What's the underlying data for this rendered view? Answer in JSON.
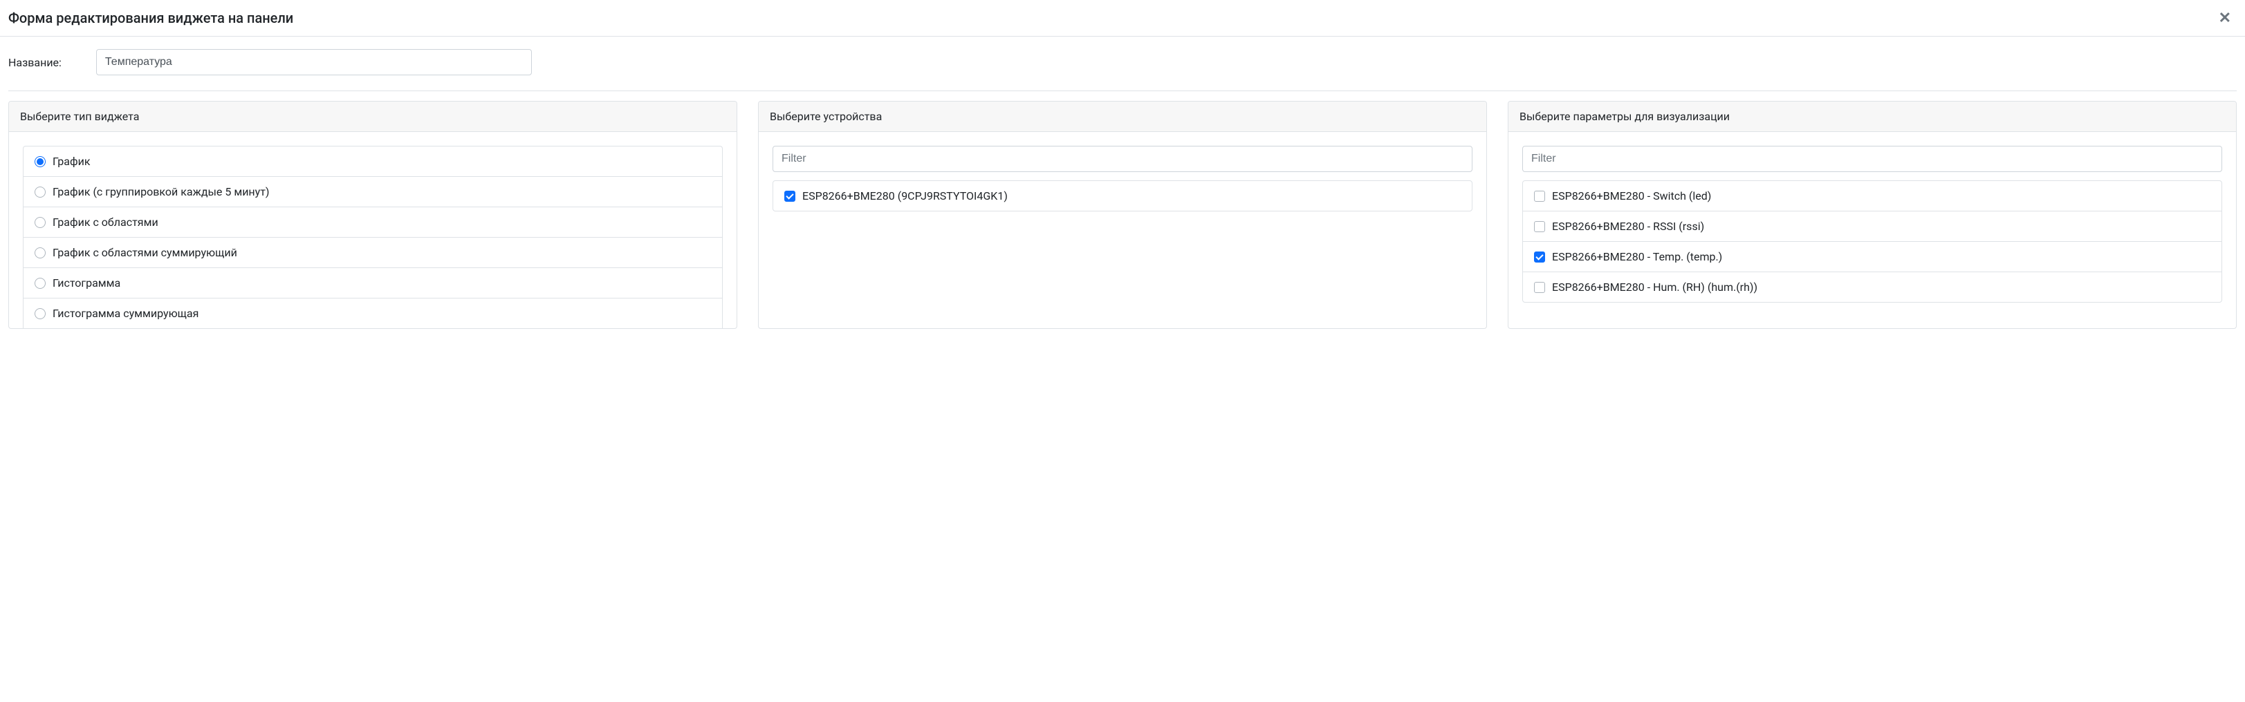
{
  "modal": {
    "title": "Форма редактирования виджета на панели"
  },
  "nameField": {
    "label": "Название:",
    "value": "Температура"
  },
  "widgetTypePanel": {
    "title": "Выберите тип виджета",
    "options": [
      {
        "label": "График",
        "checked": true
      },
      {
        "label": "График (с группировкой каждые 5 минут)",
        "checked": false
      },
      {
        "label": "График с областями",
        "checked": false
      },
      {
        "label": "График с областями суммирующий",
        "checked": false
      },
      {
        "label": "Гистограмма",
        "checked": false
      },
      {
        "label": "Гистограмма суммирующая",
        "checked": false
      }
    ]
  },
  "devicesPanel": {
    "title": "Выберите устройства",
    "filterPlaceholder": "Filter",
    "items": [
      {
        "label": "ESP8266+BME280 (9CPJ9RSTYTOI4GK1)",
        "checked": true
      }
    ]
  },
  "paramsPanel": {
    "title": "Выберите параметры для визуализации",
    "filterPlaceholder": "Filter",
    "items": [
      {
        "label": "ESP8266+BME280 - Switch (led)",
        "checked": false
      },
      {
        "label": "ESP8266+BME280 - RSSI (rssi)",
        "checked": false
      },
      {
        "label": "ESP8266+BME280 - Temp. (temp.)",
        "checked": true
      },
      {
        "label": "ESP8266+BME280 - Hum. (RH) (hum.(rh))",
        "checked": false
      }
    ]
  }
}
